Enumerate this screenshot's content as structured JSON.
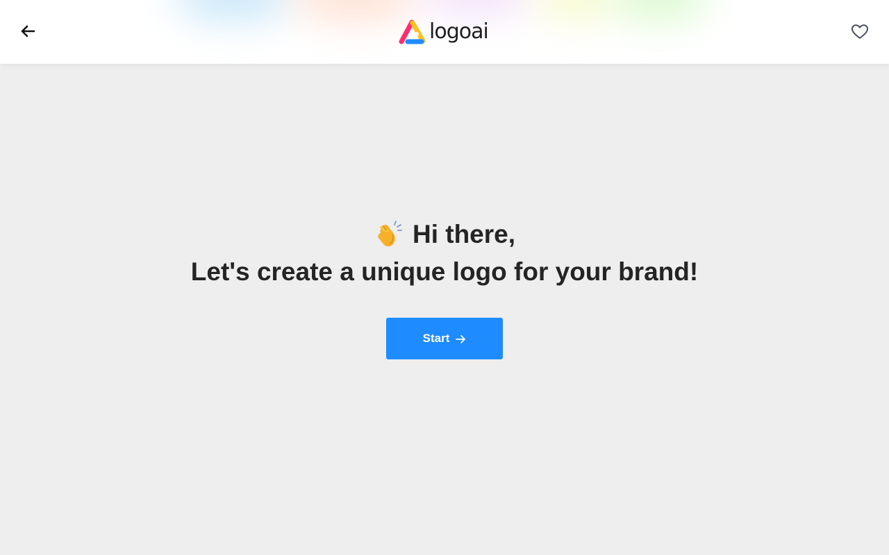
{
  "header": {
    "back_icon": "arrow-left-icon",
    "logo_text": "logoai",
    "favorite_icon": "heart-outline-icon"
  },
  "hero": {
    "emoji_icon": "clapping-hands-icon",
    "greeting": "Hi there,",
    "headline": "Let's create a unique logo for your brand!"
  },
  "start_button": {
    "label": "Start",
    "icon": "arrow-right-icon"
  },
  "colors": {
    "background": "#eeeeee",
    "header_bg": "#ffffff",
    "accent": "#1e8bff",
    "text": "#242424",
    "logo_pink": "#ff2d6f",
    "logo_yellow": "#ffc01e",
    "logo_blue": "#1f8bff"
  }
}
